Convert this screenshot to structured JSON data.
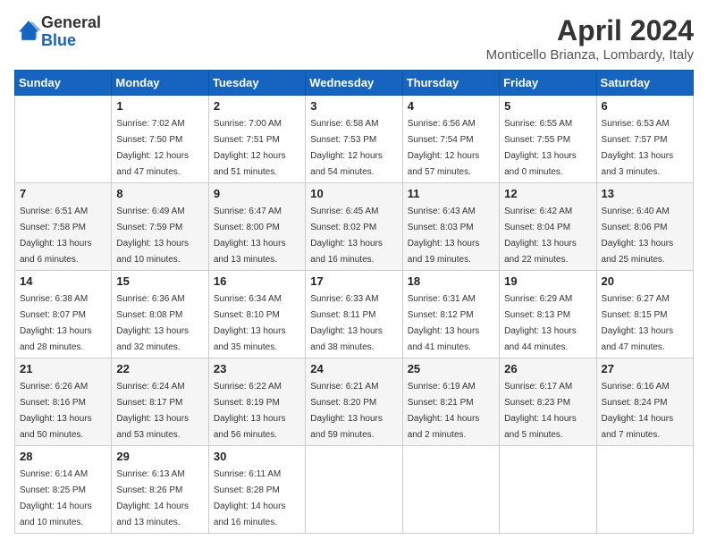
{
  "logo": {
    "text_general": "General",
    "text_blue": "Blue"
  },
  "header": {
    "title": "April 2024",
    "location": "Monticello Brianza, Lombardy, Italy"
  },
  "weekdays": [
    "Sunday",
    "Monday",
    "Tuesday",
    "Wednesday",
    "Thursday",
    "Friday",
    "Saturday"
  ],
  "weeks": [
    [
      {
        "num": "",
        "sunrise": "",
        "sunset": "",
        "daylight": ""
      },
      {
        "num": "1",
        "sunrise": "Sunrise: 7:02 AM",
        "sunset": "Sunset: 7:50 PM",
        "daylight": "Daylight: 12 hours and 47 minutes."
      },
      {
        "num": "2",
        "sunrise": "Sunrise: 7:00 AM",
        "sunset": "Sunset: 7:51 PM",
        "daylight": "Daylight: 12 hours and 51 minutes."
      },
      {
        "num": "3",
        "sunrise": "Sunrise: 6:58 AM",
        "sunset": "Sunset: 7:53 PM",
        "daylight": "Daylight: 12 hours and 54 minutes."
      },
      {
        "num": "4",
        "sunrise": "Sunrise: 6:56 AM",
        "sunset": "Sunset: 7:54 PM",
        "daylight": "Daylight: 12 hours and 57 minutes."
      },
      {
        "num": "5",
        "sunrise": "Sunrise: 6:55 AM",
        "sunset": "Sunset: 7:55 PM",
        "daylight": "Daylight: 13 hours and 0 minutes."
      },
      {
        "num": "6",
        "sunrise": "Sunrise: 6:53 AM",
        "sunset": "Sunset: 7:57 PM",
        "daylight": "Daylight: 13 hours and 3 minutes."
      }
    ],
    [
      {
        "num": "7",
        "sunrise": "Sunrise: 6:51 AM",
        "sunset": "Sunset: 7:58 PM",
        "daylight": "Daylight: 13 hours and 6 minutes."
      },
      {
        "num": "8",
        "sunrise": "Sunrise: 6:49 AM",
        "sunset": "Sunset: 7:59 PM",
        "daylight": "Daylight: 13 hours and 10 minutes."
      },
      {
        "num": "9",
        "sunrise": "Sunrise: 6:47 AM",
        "sunset": "Sunset: 8:00 PM",
        "daylight": "Daylight: 13 hours and 13 minutes."
      },
      {
        "num": "10",
        "sunrise": "Sunrise: 6:45 AM",
        "sunset": "Sunset: 8:02 PM",
        "daylight": "Daylight: 13 hours and 16 minutes."
      },
      {
        "num": "11",
        "sunrise": "Sunrise: 6:43 AM",
        "sunset": "Sunset: 8:03 PM",
        "daylight": "Daylight: 13 hours and 19 minutes."
      },
      {
        "num": "12",
        "sunrise": "Sunrise: 6:42 AM",
        "sunset": "Sunset: 8:04 PM",
        "daylight": "Daylight: 13 hours and 22 minutes."
      },
      {
        "num": "13",
        "sunrise": "Sunrise: 6:40 AM",
        "sunset": "Sunset: 8:06 PM",
        "daylight": "Daylight: 13 hours and 25 minutes."
      }
    ],
    [
      {
        "num": "14",
        "sunrise": "Sunrise: 6:38 AM",
        "sunset": "Sunset: 8:07 PM",
        "daylight": "Daylight: 13 hours and 28 minutes."
      },
      {
        "num": "15",
        "sunrise": "Sunrise: 6:36 AM",
        "sunset": "Sunset: 8:08 PM",
        "daylight": "Daylight: 13 hours and 32 minutes."
      },
      {
        "num": "16",
        "sunrise": "Sunrise: 6:34 AM",
        "sunset": "Sunset: 8:10 PM",
        "daylight": "Daylight: 13 hours and 35 minutes."
      },
      {
        "num": "17",
        "sunrise": "Sunrise: 6:33 AM",
        "sunset": "Sunset: 8:11 PM",
        "daylight": "Daylight: 13 hours and 38 minutes."
      },
      {
        "num": "18",
        "sunrise": "Sunrise: 6:31 AM",
        "sunset": "Sunset: 8:12 PM",
        "daylight": "Daylight: 13 hours and 41 minutes."
      },
      {
        "num": "19",
        "sunrise": "Sunrise: 6:29 AM",
        "sunset": "Sunset: 8:13 PM",
        "daylight": "Daylight: 13 hours and 44 minutes."
      },
      {
        "num": "20",
        "sunrise": "Sunrise: 6:27 AM",
        "sunset": "Sunset: 8:15 PM",
        "daylight": "Daylight: 13 hours and 47 minutes."
      }
    ],
    [
      {
        "num": "21",
        "sunrise": "Sunrise: 6:26 AM",
        "sunset": "Sunset: 8:16 PM",
        "daylight": "Daylight: 13 hours and 50 minutes."
      },
      {
        "num": "22",
        "sunrise": "Sunrise: 6:24 AM",
        "sunset": "Sunset: 8:17 PM",
        "daylight": "Daylight: 13 hours and 53 minutes."
      },
      {
        "num": "23",
        "sunrise": "Sunrise: 6:22 AM",
        "sunset": "Sunset: 8:19 PM",
        "daylight": "Daylight: 13 hours and 56 minutes."
      },
      {
        "num": "24",
        "sunrise": "Sunrise: 6:21 AM",
        "sunset": "Sunset: 8:20 PM",
        "daylight": "Daylight: 13 hours and 59 minutes."
      },
      {
        "num": "25",
        "sunrise": "Sunrise: 6:19 AM",
        "sunset": "Sunset: 8:21 PM",
        "daylight": "Daylight: 14 hours and 2 minutes."
      },
      {
        "num": "26",
        "sunrise": "Sunrise: 6:17 AM",
        "sunset": "Sunset: 8:23 PM",
        "daylight": "Daylight: 14 hours and 5 minutes."
      },
      {
        "num": "27",
        "sunrise": "Sunrise: 6:16 AM",
        "sunset": "Sunset: 8:24 PM",
        "daylight": "Daylight: 14 hours and 7 minutes."
      }
    ],
    [
      {
        "num": "28",
        "sunrise": "Sunrise: 6:14 AM",
        "sunset": "Sunset: 8:25 PM",
        "daylight": "Daylight: 14 hours and 10 minutes."
      },
      {
        "num": "29",
        "sunrise": "Sunrise: 6:13 AM",
        "sunset": "Sunset: 8:26 PM",
        "daylight": "Daylight: 14 hours and 13 minutes."
      },
      {
        "num": "30",
        "sunrise": "Sunrise: 6:11 AM",
        "sunset": "Sunset: 8:28 PM",
        "daylight": "Daylight: 14 hours and 16 minutes."
      },
      {
        "num": "",
        "sunrise": "",
        "sunset": "",
        "daylight": ""
      },
      {
        "num": "",
        "sunrise": "",
        "sunset": "",
        "daylight": ""
      },
      {
        "num": "",
        "sunrise": "",
        "sunset": "",
        "daylight": ""
      },
      {
        "num": "",
        "sunrise": "",
        "sunset": "",
        "daylight": ""
      }
    ]
  ]
}
